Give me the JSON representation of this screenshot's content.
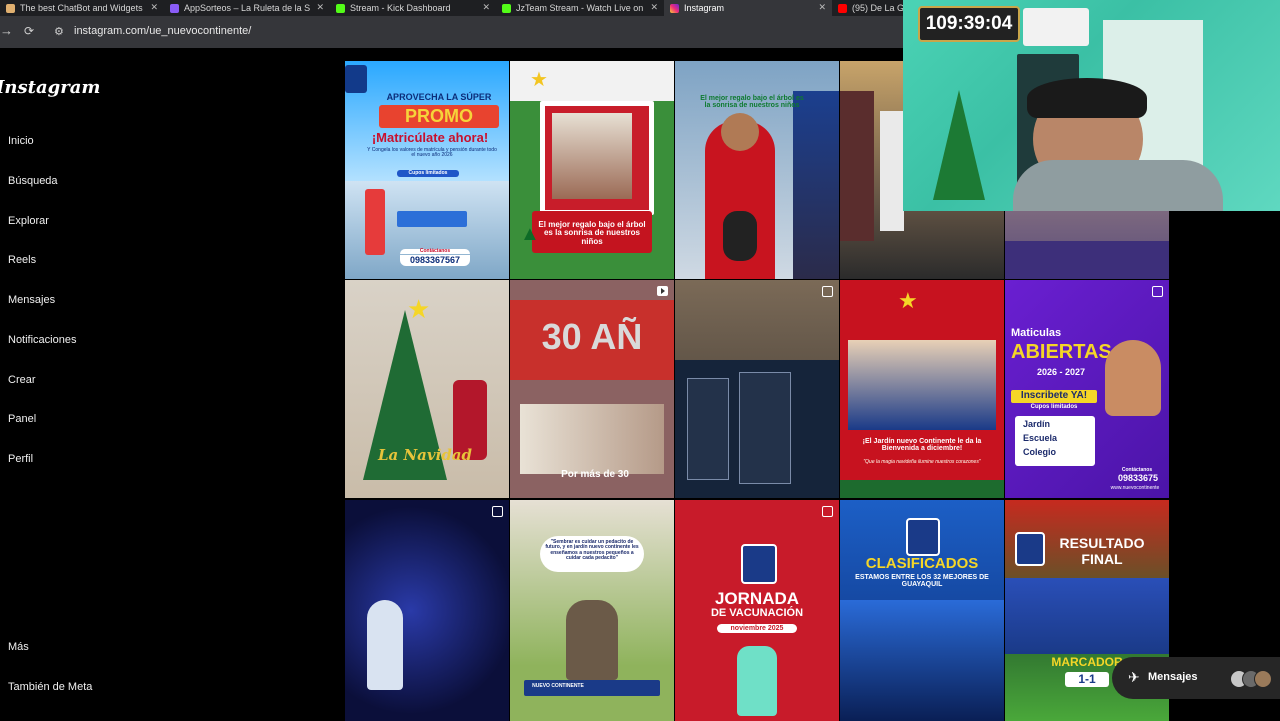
{
  "browser": {
    "tabs": [
      {
        "title": "The best ChatBot and Widgets",
        "favicon_color": "#e0b070"
      },
      {
        "title": "AppSorteos – La Ruleta de la S",
        "favicon_color": "#8a5cf6"
      },
      {
        "title": "Stream - Kick Dashboard",
        "favicon_color": "#53fc18"
      },
      {
        "title": "JzTeam Stream - Watch Live on",
        "favicon_color": "#53fc18"
      },
      {
        "title": "Instagram",
        "favicon_color": "#e1306c"
      },
      {
        "title": "(95) De La G",
        "favicon_color": "#ff0000"
      }
    ],
    "back_icon": "→",
    "reload_icon": "⟳",
    "url": "instagram.com/ue_nuevocontinente/"
  },
  "sidebar": {
    "logo": "Instagram",
    "items": [
      "Inicio",
      "Búsqueda",
      "Explorar",
      "Reels",
      "Mensajes",
      "Notificaciones",
      "Crear",
      "Panel",
      "Perfil"
    ],
    "bottom": [
      "Más",
      "También de Meta"
    ]
  },
  "posts": {
    "p1": {
      "line1": "APROVECHA LA SÚPER",
      "line2": "PROMO",
      "line3": "¡Matricúlate ahora!",
      "line4": "Y Congela los valores de matrícula y pensión durante todo el nuevo año 2026",
      "badge": "Cupos limitados",
      "phone_label": "Contáctanos",
      "phone": "0983367567"
    },
    "p2": {
      "text": "El mejor regalo bajo el árbol es la sonrisa de nuestros niños"
    },
    "p3": {
      "text": "El mejor regalo bajo el árbol es la sonrisa de nuestros niños"
    },
    "p6": {
      "text": "La Navidad"
    },
    "p7": {
      "big": "30 AÑ",
      "sub": "Por más de 30"
    },
    "p9": {
      "text": "¡El Jardín nuevo Continente le da la Bienvenida a diciembre!",
      "sub": "\"Que la magia navideña ilumine nuestros corazones\""
    },
    "p10": {
      "line1": "Maticulas",
      "line2": "ABIERTAS",
      "line3": "2026 - 2027",
      "line4": "Inscribete YA!",
      "line5": "Cupos limitados",
      "items": [
        "Jardín",
        "Escuela",
        "Colegio"
      ],
      "contact": "Contáctanos",
      "phone": "09833675",
      "web": "www.nuevocontinente"
    },
    "p12": {
      "quote": "\"Sembrar es cuidar un pedacito de futuro, y en jardín nuevo continente les enseñamos a nuestros pequeños a cuidar cada pedacito\"",
      "footer": "NUEVO CONTINENTE"
    },
    "p13": {
      "line1": "JORNADA",
      "line2": "DE VACUNACIÓN",
      "line3": "noviembre 2025"
    },
    "p14": {
      "line1": "CLASIFICADOS",
      "line2": "ESTAMOS ENTRE LOS 32 MEJORES DE GUAYAQUIL"
    },
    "p15": {
      "line1": "RESULTADO",
      "line2": "FINAL",
      "line3": "MARCADOR",
      "score": "1-1"
    }
  },
  "overlay": {
    "timer": "109:39:04",
    "messages_label": "Mensajes"
  }
}
